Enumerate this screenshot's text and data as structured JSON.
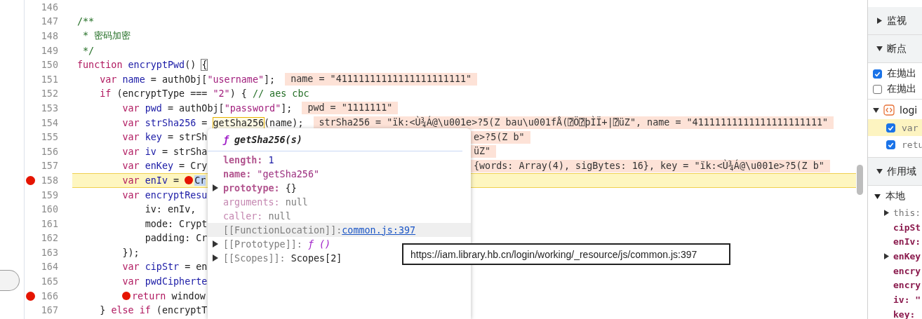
{
  "editor": {
    "lines": [
      {
        "number": "146",
        "breakpoint": false,
        "current": false
      },
      {
        "number": "147",
        "breakpoint": false,
        "current": false,
        "tokens": [
          {
            "kind": "comment",
            "text": "/**"
          }
        ]
      },
      {
        "number": "148",
        "breakpoint": false,
        "current": false,
        "tokens": [
          {
            "kind": "comment",
            "text": " * 密码加密"
          }
        ]
      },
      {
        "number": "149",
        "breakpoint": false,
        "current": false,
        "tokens": [
          {
            "kind": "comment",
            "text": " */"
          }
        ]
      },
      {
        "number": "150",
        "breakpoint": false,
        "current": false,
        "tokens": [
          {
            "kind": "keyword",
            "text": "function"
          },
          {
            "kind": "definition",
            "text": " encryptPwd"
          },
          {
            "kind": "plain",
            "text": "() "
          },
          {
            "kind": "bracket",
            "text": "{"
          }
        ]
      },
      {
        "number": "151",
        "breakpoint": false,
        "current": false,
        "tokens": [
          {
            "kind": "keyword",
            "text": "    var"
          },
          {
            "kind": "definition",
            "text": " name"
          },
          {
            "kind": "plain",
            "text": " = authObj["
          },
          {
            "kind": "string",
            "text": "\"username\""
          },
          {
            "kind": "plain",
            "text": "];"
          }
        ],
        "annotation": "name = \"41111111111111111111111\""
      },
      {
        "number": "152",
        "breakpoint": false,
        "current": false,
        "tokens": [
          {
            "kind": "keyword",
            "text": "    if"
          },
          {
            "kind": "plain",
            "text": " (encryptType === "
          },
          {
            "kind": "string",
            "text": "\"2\""
          },
          {
            "kind": "plain",
            "text": ") { "
          },
          {
            "kind": "comment",
            "text": "// aes cbc"
          }
        ]
      },
      {
        "number": "153",
        "breakpoint": false,
        "current": false,
        "tokens": [
          {
            "kind": "keyword",
            "text": "        var"
          },
          {
            "kind": "definition",
            "text": " pwd"
          },
          {
            "kind": "plain",
            "text": " = authObj["
          },
          {
            "kind": "string",
            "text": "\"password\""
          },
          {
            "kind": "plain",
            "text": "];"
          }
        ],
        "annotation": "pwd = \"1111111\""
      },
      {
        "number": "154",
        "breakpoint": false,
        "current": false,
        "tokens": [
          {
            "kind": "keyword",
            "text": "        var"
          },
          {
            "kind": "definition",
            "text": " strSha256"
          },
          {
            "kind": "plain",
            "text": " = "
          },
          {
            "kind": "hover",
            "text": "getSha256"
          },
          {
            "kind": "plain",
            "text": "(name);"
          }
        ],
        "annotation": "strSha256 = \"ïk:<Ù¾Á@\\u001e>?5(Z bau\\u001fÅ(⍰Ö⍰þÌÏ+|⍰üZ\", name = \"41111111111111111111111\""
      },
      {
        "number": "155",
        "breakpoint": false,
        "current": false,
        "tokens": [
          {
            "kind": "keyword",
            "text": "        var"
          },
          {
            "kind": "definition",
            "text": " key"
          },
          {
            "kind": "plain",
            "text": " = strSh"
          }
        ],
        "annotation_tail": "e>?5(Z b\""
      },
      {
        "number": "156",
        "breakpoint": false,
        "current": false,
        "tokens": [
          {
            "kind": "keyword",
            "text": "        var"
          },
          {
            "kind": "definition",
            "text": " iv"
          },
          {
            "kind": "plain",
            "text": " = strSha"
          }
        ],
        "annotation_tail": "üZ\""
      },
      {
        "number": "157",
        "breakpoint": false,
        "current": false,
        "tokens": [
          {
            "kind": "keyword",
            "text": "        var"
          },
          {
            "kind": "definition",
            "text": " enKey"
          },
          {
            "kind": "plain",
            "text": " = Cry"
          }
        ],
        "annotation_tail": "{words: Array(4), sigBytes: 16}, key = \"ïk:<Ù¾Á@\\u001e>?5(Z b\""
      },
      {
        "number": "158",
        "breakpoint": true,
        "current": true,
        "tokens": [
          {
            "kind": "keyword",
            "text": "        var"
          },
          {
            "kind": "definition",
            "text": " enIv"
          },
          {
            "kind": "plain",
            "text": " = "
          },
          {
            "kind": "breakpoint"
          },
          {
            "kind": "selected",
            "text": "Cr"
          }
        ]
      },
      {
        "number": "159",
        "breakpoint": false,
        "current": false,
        "tokens": [
          {
            "kind": "keyword",
            "text": "        var"
          },
          {
            "kind": "definition",
            "text": " encryptResu"
          }
        ]
      },
      {
        "number": "160",
        "breakpoint": false,
        "current": false,
        "tokens": [
          {
            "kind": "plain",
            "text": "            iv: enIv,"
          }
        ]
      },
      {
        "number": "161",
        "breakpoint": false,
        "current": false,
        "tokens": [
          {
            "kind": "plain",
            "text": "            mode: Crypt"
          }
        ]
      },
      {
        "number": "162",
        "breakpoint": false,
        "current": false,
        "tokens": [
          {
            "kind": "plain",
            "text": "            padding: Cr"
          }
        ]
      },
      {
        "number": "163",
        "breakpoint": false,
        "current": false,
        "tokens": [
          {
            "kind": "plain",
            "text": "        });"
          }
        ]
      },
      {
        "number": "164",
        "breakpoint": false,
        "current": false,
        "tokens": [
          {
            "kind": "keyword",
            "text": "        var"
          },
          {
            "kind": "definition",
            "text": " cipStr"
          },
          {
            "kind": "plain",
            "text": " = en"
          }
        ]
      },
      {
        "number": "165",
        "breakpoint": false,
        "current": false,
        "tokens": [
          {
            "kind": "keyword",
            "text": "        var"
          },
          {
            "kind": "definition",
            "text": " pwdCipherte"
          }
        ]
      },
      {
        "number": "166",
        "breakpoint": true,
        "current": false,
        "tokens": [
          {
            "kind": "breakpoint"
          },
          {
            "kind": "keyword",
            "text": "return"
          },
          {
            "kind": "plain",
            "text": " window"
          }
        ]
      },
      {
        "number": "167",
        "breakpoint": false,
        "current": false,
        "tokens": [
          {
            "kind": "plain",
            "text": "    } "
          },
          {
            "kind": "keyword",
            "text": "else if"
          },
          {
            "kind": "plain",
            "text": " (encryptT"
          }
        ]
      }
    ]
  },
  "popover": {
    "glyph": "ƒ",
    "title": "getSha256(s)",
    "properties": [
      {
        "key": {
          "text": "length:",
          "kind": "enumerable"
        },
        "value": {
          "text": " 1",
          "kind": "number"
        },
        "expandable": false,
        "highlighted": false
      },
      {
        "key": {
          "text": "name:",
          "kind": "enumerable"
        },
        "value": {
          "text": " \"getSha256\"",
          "kind": "string"
        },
        "expandable": false,
        "highlighted": false
      },
      {
        "key": {
          "text": "prototype:",
          "kind": "enumerable"
        },
        "value": {
          "text": " {}",
          "kind": "object"
        },
        "expandable": true,
        "highlighted": false
      },
      {
        "key": {
          "text": "arguments:",
          "kind": "nonenumerable"
        },
        "value": {
          "text": " null",
          "kind": "null"
        },
        "expandable": false,
        "highlighted": false
      },
      {
        "key": {
          "text": "caller:",
          "kind": "nonenumerable"
        },
        "value": {
          "text": " null",
          "kind": "null"
        },
        "expandable": false,
        "highlighted": false
      },
      {
        "key": {
          "text": "[[FunctionLocation]]:",
          "kind": "internal"
        },
        "value": {
          "text": "common.js:397",
          "kind": "link"
        },
        "expandable": false,
        "highlighted": true
      },
      {
        "key": {
          "text": "[[Prototype]]:",
          "kind": "internal"
        },
        "value": {
          "text": " ƒ ()",
          "kind": "function"
        },
        "expandable": true,
        "highlighted": false
      },
      {
        "key": {
          "text": "[[Scopes]]:",
          "kind": "internal"
        },
        "value": {
          "text": " Scopes[2]",
          "kind": "object"
        },
        "expandable": true,
        "highlighted": false
      }
    ]
  },
  "tooltip": {
    "text": "https://iam.library.hb.cn/login/working/_resource/js/common.js:397"
  },
  "sidebar": {
    "watch": {
      "title": "监视",
      "expanded": false
    },
    "breakpoints": {
      "title": "断点",
      "expanded": true,
      "options": [
        {
          "label": "在抛出",
          "checked": true
        },
        {
          "label": "在抛出",
          "checked": false
        }
      ],
      "file": {
        "name": "logi",
        "expanded": true
      },
      "items": [
        {
          "code": "var",
          "checked": true,
          "selected": true
        },
        {
          "code": "retu",
          "checked": true,
          "selected": false
        }
      ]
    },
    "scope": {
      "title": "作用域",
      "expanded": true,
      "local": {
        "title": "本地",
        "expanded": true,
        "vars": [
          {
            "text": "this:",
            "kind": "internal",
            "expandable": true
          },
          {
            "text": "cipSt",
            "kind": "own",
            "expandable": false
          },
          {
            "text": "enIv:",
            "kind": "own",
            "expandable": false
          },
          {
            "text": "enKey",
            "kind": "own",
            "expandable": true
          },
          {
            "text": "encry",
            "kind": "own",
            "expandable": false
          },
          {
            "text": "encry",
            "kind": "own",
            "expandable": false
          },
          {
            "text": "iv: \"",
            "kind": "own",
            "expandable": false
          },
          {
            "text": "key:",
            "kind": "own",
            "expandable": false
          }
        ]
      }
    }
  }
}
